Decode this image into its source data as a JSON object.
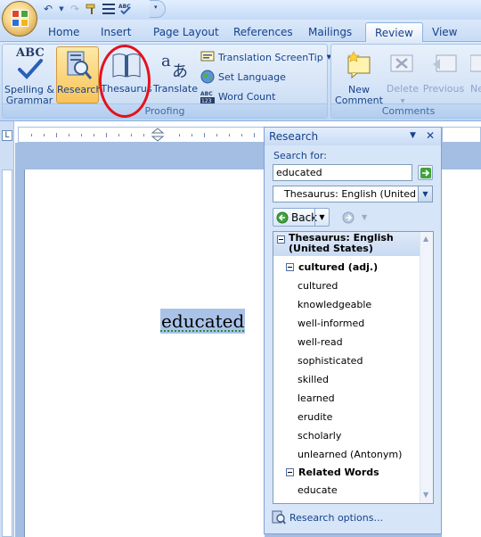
{
  "colors": {
    "accent": "#15428b",
    "annotation": "#e4121d",
    "selection": "#a9c3e8"
  },
  "tabs": [
    {
      "label": "Home",
      "active": false
    },
    {
      "label": "Insert",
      "active": false
    },
    {
      "label": "Page Layout",
      "active": false
    },
    {
      "label": "References",
      "active": false
    },
    {
      "label": "Mailings",
      "active": false
    },
    {
      "label": "Review",
      "active": true
    },
    {
      "label": "View",
      "active": false
    }
  ],
  "ribbon": {
    "proofing": {
      "label": "Proofing",
      "spelling": "Spelling & Grammar",
      "spelling_line1": "Spelling &",
      "spelling_line2": "Grammar",
      "spelling_icon_text": "ABC",
      "research": "Research",
      "thesaurus": "Thesaurus",
      "translate": "Translate",
      "translation_screentip": "Translation ScreenTip",
      "set_language": "Set Language",
      "word_count": "Word Count"
    },
    "comments": {
      "label": "Comments",
      "new_comment_line1": "New",
      "new_comment_line2": "Comment",
      "delete": "Delete",
      "previous": "Previous",
      "next": "Ne"
    }
  },
  "document": {
    "selected_word": "educated"
  },
  "research_pane": {
    "title": "Research",
    "search_label": "Search for:",
    "search_value": "educated",
    "source": "Thesaurus: English (United States)",
    "back_label": "Back",
    "results_header": "Thesaurus: English (United States)",
    "results_header_line1": "Thesaurus: English",
    "results_header_line2": "(United States)",
    "groups": [
      {
        "title": "cultured (adj.)",
        "items": [
          "cultured",
          "knowledgeable",
          "well-informed",
          "well-read",
          "sophisticated",
          "skilled",
          "learned",
          "erudite",
          "scholarly",
          "unlearned (Antonym)"
        ]
      },
      {
        "title": "Related Words",
        "items": [
          "educate"
        ]
      }
    ],
    "options_link": "Research options..."
  }
}
